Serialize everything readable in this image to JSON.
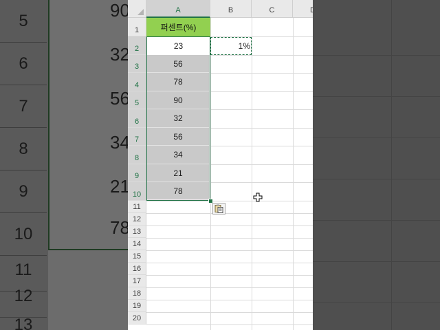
{
  "background_left": {
    "row_numbers": [
      "5",
      "6",
      "7",
      "8",
      "9",
      "10",
      "11",
      "12",
      "13"
    ],
    "partial_values": [
      "90",
      "32",
      "56",
      "34",
      "21",
      "78"
    ]
  },
  "sheet": {
    "columns": [
      "A",
      "B",
      "C",
      "D"
    ],
    "rows": [
      "1",
      "2",
      "3",
      "4",
      "5",
      "6",
      "7",
      "8",
      "9",
      "10",
      "11",
      "12",
      "13",
      "14",
      "15",
      "16",
      "17",
      "18",
      "19",
      "20"
    ],
    "header_cell": "퍼센트(%)",
    "column_a_values": [
      "23",
      "56",
      "78",
      "90",
      "32",
      "56",
      "34",
      "21",
      "78"
    ],
    "b2_value": "1%"
  },
  "icons": {
    "paste_options": "paste-options-icon",
    "cursor": "cell-select-cursor-icon"
  },
  "colors": {
    "header_fill": "#92d050",
    "selection_fill": "#c9c9c9",
    "excel_green": "#217346"
  }
}
